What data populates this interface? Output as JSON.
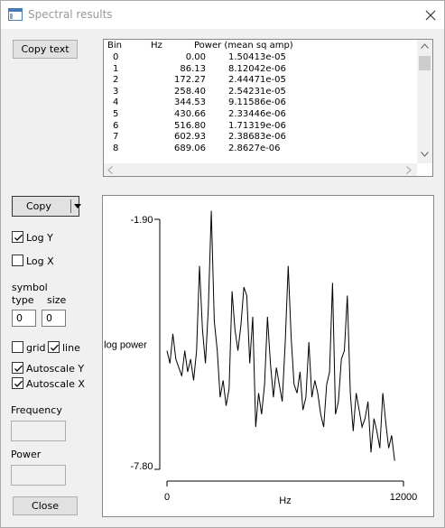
{
  "window": {
    "title": "Spectral results"
  },
  "buttons": {
    "copy_text": "Copy text",
    "copy": "Copy",
    "close": "Close"
  },
  "table": {
    "headers": {
      "bin": "Bin",
      "hz": "Hz",
      "power": "Power (mean sq amp)"
    },
    "rows": [
      {
        "bin": "0",
        "hz": "0.00",
        "power": "1.50413e-05"
      },
      {
        "bin": "1",
        "hz": "86.13",
        "power": "8.12042e-06"
      },
      {
        "bin": "2",
        "hz": "172.27",
        "power": "2.44471e-05"
      },
      {
        "bin": "3",
        "hz": "258.40",
        "power": "2.54231e-05"
      },
      {
        "bin": "4",
        "hz": "344.53",
        "power": "9.11586e-06"
      },
      {
        "bin": "5",
        "hz": "430.66",
        "power": "2.33446e-06"
      },
      {
        "bin": "6",
        "hz": "516.80",
        "power": "1.71319e-06"
      },
      {
        "bin": "7",
        "hz": "602.93",
        "power": "2.38683e-06"
      },
      {
        "bin": "8",
        "hz": "689.06",
        "power": "2.8627e-06"
      }
    ]
  },
  "options": {
    "log_y": {
      "label": "Log Y",
      "checked": true
    },
    "log_x": {
      "label": "Log X",
      "checked": false
    },
    "symbol_label": "symbol",
    "type_label": "type",
    "size_label": "size",
    "symbol_type": "0",
    "symbol_size": "0",
    "grid": {
      "label": "grid",
      "checked": false
    },
    "line": {
      "label": "line",
      "checked": true
    },
    "autoscale_y": {
      "label": "Autoscale  Y",
      "checked": true
    },
    "autoscale_x": {
      "label": "Autoscale  X",
      "checked": true
    },
    "frequency_label": "Frequency",
    "frequency_value": "",
    "power_label": "Power",
    "power_value": ""
  },
  "chart_data": {
    "type": "line",
    "xlabel": "Hz",
    "ylabel": "log power",
    "x_ticks": [
      "0",
      "12000"
    ],
    "y_ticks": [
      "-1.90",
      "-7.80"
    ],
    "xlim": [
      0,
      12000
    ],
    "ylim": [
      -7.8,
      -1.9
    ],
    "grid": false,
    "x": [
      0,
      150,
      300,
      450,
      600,
      750,
      900,
      1050,
      1200,
      1350,
      1500,
      1650,
      1800,
      1950,
      2100,
      2250,
      2400,
      2550,
      2700,
      2850,
      3000,
      3150,
      3300,
      3450,
      3600,
      3750,
      3900,
      4050,
      4200,
      4350,
      4500,
      4650,
      4800,
      4950,
      5100,
      5250,
      5400,
      5550,
      5700,
      5850,
      6000,
      6150,
      6300,
      6450,
      6600,
      6750,
      6900,
      7050,
      7200,
      7350,
      7500,
      7650,
      7800,
      7950,
      8100,
      8250,
      8400,
      8550,
      8700,
      8850,
      9000,
      9150,
      9300,
      9450,
      9600,
      9750,
      9900,
      10050,
      10200,
      10350,
      10500,
      10650,
      10800,
      10950,
      11100,
      11250,
      11400,
      11550
    ],
    "y": [
      -5.0,
      -5.3,
      -4.6,
      -5.2,
      -5.4,
      -5.6,
      -5.0,
      -5.5,
      -5.2,
      -5.7,
      -5.0,
      -3.0,
      -4.5,
      -5.3,
      -4.0,
      -1.7,
      -4.3,
      -5.0,
      -6.1,
      -5.7,
      -6.3,
      -5.9,
      -3.6,
      -4.5,
      -5.0,
      -4.4,
      -3.5,
      -3.7,
      -5.3,
      -4.2,
      -6.8,
      -6.0,
      -6.5,
      -5.8,
      -4.2,
      -5.3,
      -6.1,
      -5.4,
      -5.8,
      -6.2,
      -4.8,
      -3.0,
      -4.7,
      -5.8,
      -6.0,
      -5.5,
      -6.4,
      -6.1,
      -4.8,
      -6.1,
      -5.7,
      -6.0,
      -6.5,
      -6.8,
      -5.8,
      -5.5,
      -3.4,
      -6.5,
      -6.2,
      -5.2,
      -5.0,
      -3.7,
      -6.0,
      -6.9,
      -6.0,
      -6.4,
      -6.8,
      -6.6,
      -6.2,
      -7.4,
      -6.6,
      -6.9,
      -7.3,
      -6.0,
      -6.7,
      -7.3,
      -7.0,
      -7.6
    ]
  }
}
